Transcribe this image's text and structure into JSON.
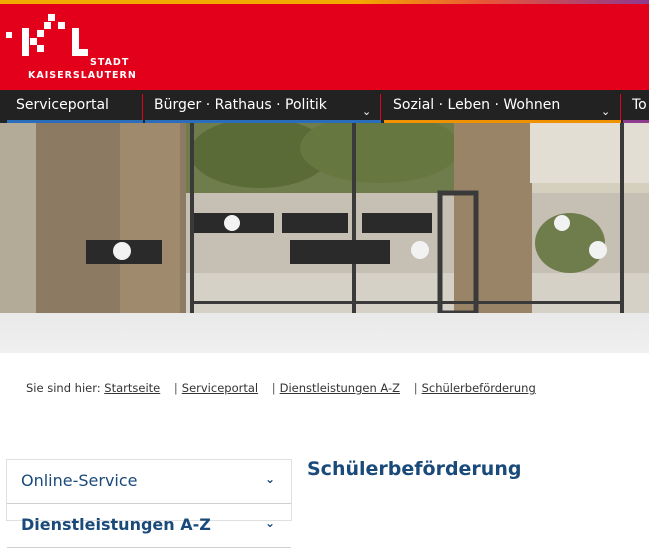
{
  "header": {
    "logo_mark": "KL",
    "logo_stadt": "STADT",
    "logo_name": "KAISERSLAUTERN",
    "brand_color": "#e2001a"
  },
  "nav": {
    "items": [
      {
        "label": "Serviceportal",
        "accent": "#2a6ebb",
        "has_dropdown": false
      },
      {
        "label": "Bürger · Rathaus · Politik",
        "accent": "#2a6ebb",
        "has_dropdown": true
      },
      {
        "label": "Sozial · Leben · Wohnen",
        "accent": "#f29100",
        "has_dropdown": true
      },
      {
        "label": "To",
        "accent": "#8e3b8f",
        "has_dropdown": false
      }
    ],
    "dropdown_icon": "chevron-down-icon"
  },
  "hero": {
    "image": "glass-entrance-photo"
  },
  "breadcrumb": {
    "prefix": "Sie sind hier:",
    "items": [
      "Startseite",
      "Serviceportal",
      "Dienstleistungen A-Z",
      "Schülerbeförderung"
    ]
  },
  "sidebar": {
    "items": [
      {
        "label": "Online-Service"
      },
      {
        "label": "Dienstleistungen A-Z"
      }
    ]
  },
  "main": {
    "title": "Schülerbeförderung"
  }
}
